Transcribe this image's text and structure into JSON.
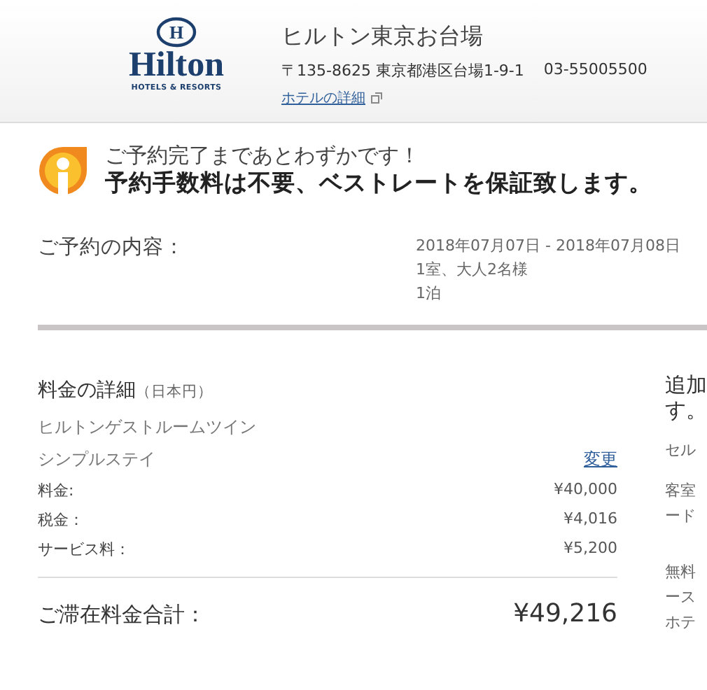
{
  "header": {
    "logo": {
      "emblem_letter": "H",
      "wordmark": "Hilton",
      "tagline": "HOTELS & RESORTS"
    },
    "hotel_name": "ヒルトン東京お台場",
    "address": "〒135-8625 東京都港区台場1-9-1",
    "phone": "03-55005500",
    "details_link": "ホテルの詳細"
  },
  "notice": {
    "line_1": "ご予約完了まであとわずかです！",
    "line_2": "予約手数料は不要、ベストレートを保証致します。"
  },
  "reservation": {
    "label": "ご予約の内容：",
    "lines": [
      "2018年07月07日 - 2018年07月08日",
      "1室、大人2名様",
      "1泊"
    ]
  },
  "price_details": {
    "title": "料金の詳細",
    "currency": "（日本円）",
    "room_type": "ヒルトンゲストルームツイン",
    "rate_plan": "シンプルステイ",
    "change_link": "変更",
    "rows": [
      {
        "label": "料金:",
        "amount": "¥40,000"
      },
      {
        "label": "税金：",
        "amount": "¥4,016"
      },
      {
        "label": "サービス料：",
        "amount": "¥5,200"
      }
    ],
    "total_label": "ご滞在料金合計：",
    "total_amount": "¥49,216"
  },
  "side_panel": {
    "heading_lines": [
      "追加",
      "す。"
    ],
    "paragraphs": [
      [
        "セル"
      ],
      [
        "客室",
        "ード"
      ],
      [
        "無料",
        "ース",
        "ホテ"
      ]
    ]
  }
}
